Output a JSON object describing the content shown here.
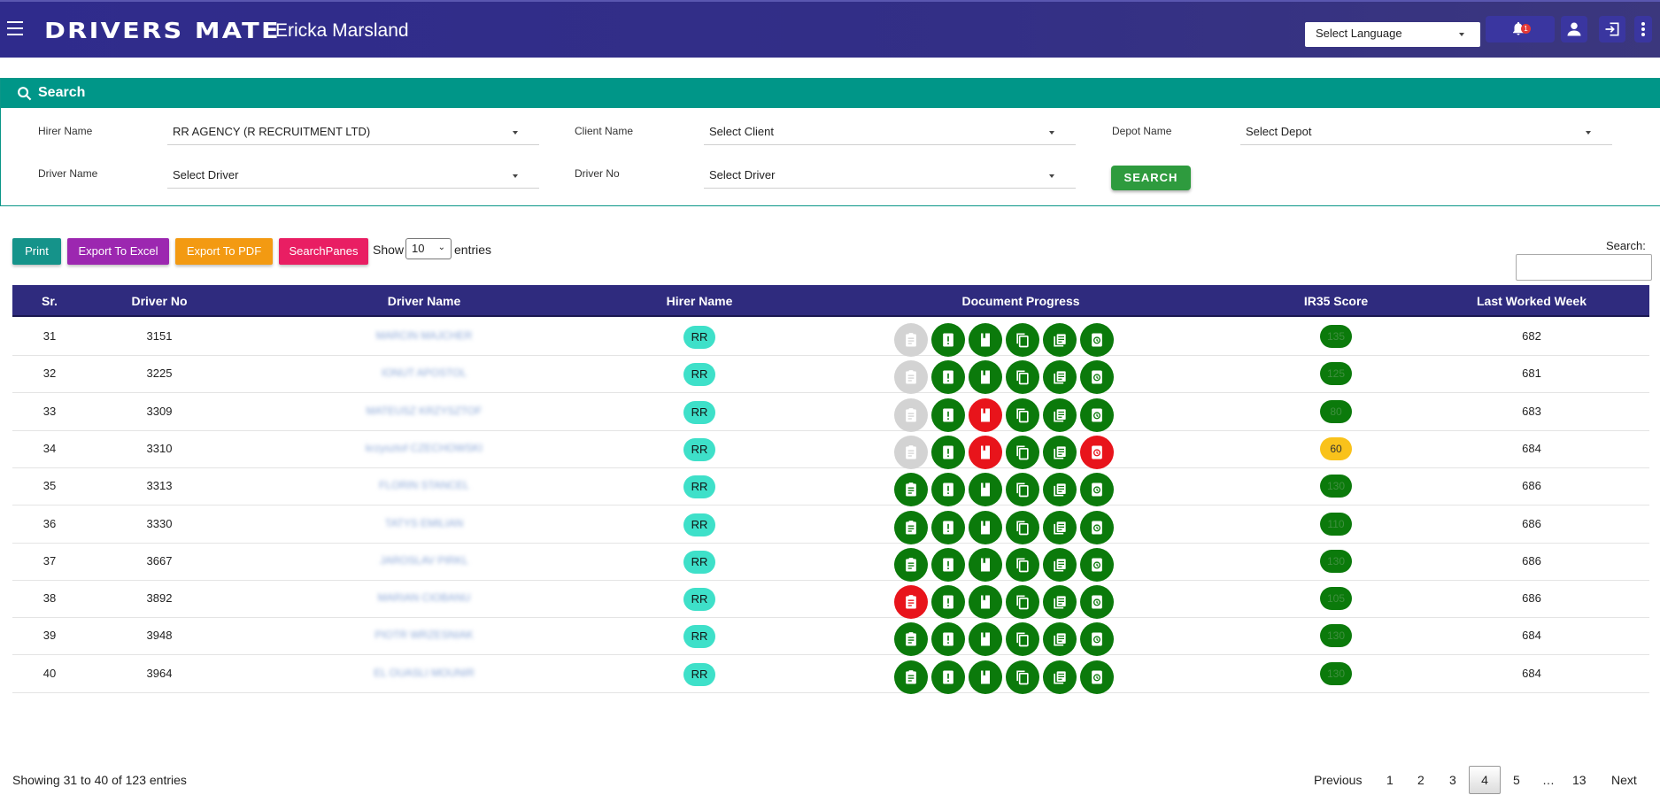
{
  "header": {
    "brand": "DRIVERS MATE",
    "user_name": "Ericka Marsland",
    "language_select": "Select Language",
    "notification_count": "1",
    "icons": [
      "menu-icon",
      "bell-icon",
      "user-icon",
      "logout-icon",
      "more-vertical-icon"
    ]
  },
  "search_panel": {
    "title": "Search",
    "hirer_label": "Hirer Name",
    "hirer_value": "RR AGENCY (R RECRUITMENT LTD)",
    "client_label": "Client Name",
    "client_value": "Select Client",
    "depot_label": "Depot Name",
    "depot_value": "Select Depot",
    "driver_label": "Driver Name",
    "driver_value": "Select Driver",
    "driverno_label": "Driver No",
    "driverno_value": "Select Driver",
    "search_button": "SEARCH"
  },
  "toolbar": {
    "print": "Print",
    "excel": "Export To Excel",
    "pdf": "Export To PDF",
    "panes": "SearchPanes",
    "show_label": "Show",
    "show_value": "10",
    "entries_label": "entries",
    "search_label": "Search:"
  },
  "table": {
    "headers": [
      "Sr.",
      "Driver No",
      "Driver Name",
      "Hirer Name",
      "Document Progress",
      "IR35 Score",
      "Last Worked Week"
    ],
    "doc_icons": [
      "clipboard-icon",
      "alert-doc-icon",
      "book-icon",
      "copy-icon",
      "list-doc-icon",
      "history-icon"
    ],
    "rows": [
      {
        "sr": "31",
        "no": "3151",
        "name": "MARCIN MAJCHER",
        "hirer": "RR",
        "docs": [
          "grey",
          "green",
          "green",
          "green",
          "green",
          "green"
        ],
        "score": "135",
        "score_color": "green",
        "week": "682"
      },
      {
        "sr": "32",
        "no": "3225",
        "name": "IONUT APOSTOL",
        "hirer": "RR",
        "docs": [
          "grey",
          "green",
          "green",
          "green",
          "green",
          "green"
        ],
        "score": "125",
        "score_color": "green",
        "week": "681"
      },
      {
        "sr": "33",
        "no": "3309",
        "name": "MATEUSZ KRZYSZTOF",
        "hirer": "RR",
        "docs": [
          "grey",
          "green",
          "red",
          "green",
          "green",
          "green"
        ],
        "score": "80",
        "score_color": "green",
        "week": "683"
      },
      {
        "sr": "34",
        "no": "3310",
        "name": "krzysztof CZECHOWSKI",
        "hirer": "RR",
        "docs": [
          "grey",
          "green",
          "red",
          "green",
          "green",
          "red"
        ],
        "score": "60",
        "score_color": "amber",
        "week": "684"
      },
      {
        "sr": "35",
        "no": "3313",
        "name": "FLORIN STANCEL",
        "hirer": "RR",
        "docs": [
          "green",
          "green",
          "green",
          "green",
          "green",
          "green"
        ],
        "score": "130",
        "score_color": "green",
        "week": "686"
      },
      {
        "sr": "36",
        "no": "3330",
        "name": "TATYS EMILIAN",
        "hirer": "RR",
        "docs": [
          "green",
          "green",
          "green",
          "green",
          "green",
          "green"
        ],
        "score": "110",
        "score_color": "green",
        "week": "686"
      },
      {
        "sr": "37",
        "no": "3667",
        "name": "JAROSLAV PIRKL",
        "hirer": "RR",
        "docs": [
          "green",
          "green",
          "green",
          "green",
          "green",
          "green"
        ],
        "score": "130",
        "score_color": "green",
        "week": "686"
      },
      {
        "sr": "38",
        "no": "3892",
        "name": "MARIAN CIOBANU",
        "hirer": "RR",
        "docs": [
          "red",
          "green",
          "green",
          "green",
          "green",
          "green"
        ],
        "score": "105",
        "score_color": "green",
        "week": "686"
      },
      {
        "sr": "39",
        "no": "3948",
        "name": "PIOTR WRZESNIAK",
        "hirer": "RR",
        "docs": [
          "green",
          "green",
          "green",
          "green",
          "green",
          "green"
        ],
        "score": "130",
        "score_color": "green",
        "week": "684"
      },
      {
        "sr": "40",
        "no": "3964",
        "name": "EL OUASLI MOUNIR",
        "hirer": "RR",
        "docs": [
          "green",
          "green",
          "green",
          "green",
          "green",
          "green"
        ],
        "score": "130",
        "score_color": "green",
        "week": "684"
      }
    ]
  },
  "footer": {
    "info": "Showing 31 to 40 of 123 entries",
    "previous": "Previous",
    "pages": [
      "1",
      "2",
      "3",
      "4",
      "5",
      "…",
      "13"
    ],
    "current_page": "4",
    "next": "Next"
  },
  "colors": {
    "header_bg": "#2f2b8c",
    "search_teal": "#009688",
    "doc_green": "#0b7a0b",
    "doc_red": "#e8141b",
    "doc_grey": "#d3d3d3",
    "score_amber": "#f9c21b",
    "pill_teal": "#3ee0c9",
    "print_btn": "#15938a",
    "excel_btn": "#9c27b0",
    "pdf_btn": "#f39a12",
    "panes_btn": "#e91e63"
  }
}
